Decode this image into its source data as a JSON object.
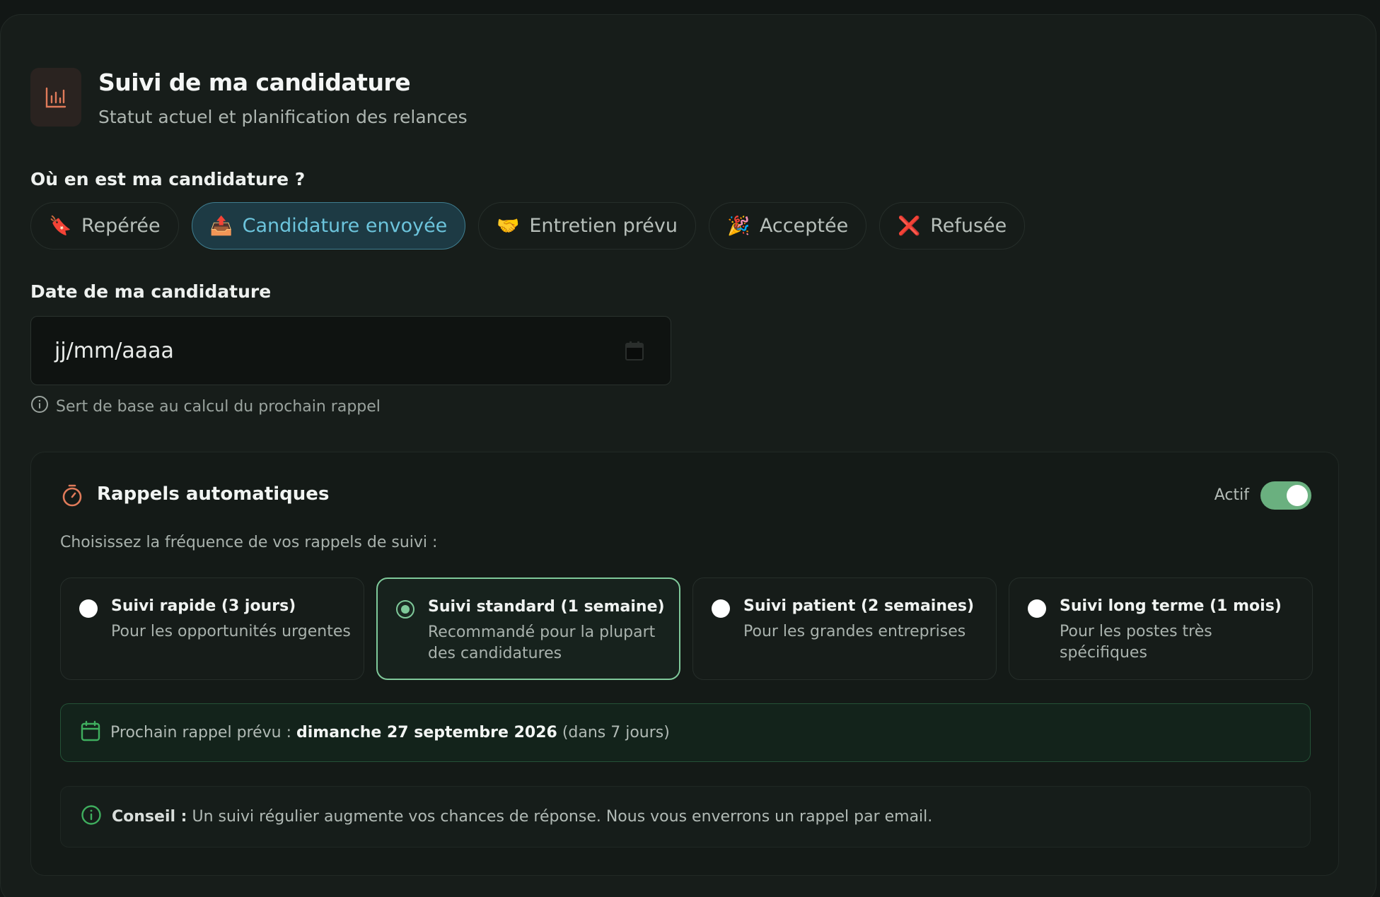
{
  "header": {
    "icon": "chart-bars-icon",
    "title": "Suivi de ma candidature",
    "subtitle": "Statut actuel et planification des relances"
  },
  "status": {
    "label": "Où en est ma candidature ?",
    "options": [
      {
        "emoji": "🔖",
        "label": "Repérée"
      },
      {
        "emoji": "📤",
        "label": "Candidature envoyée"
      },
      {
        "emoji": "🤝",
        "label": "Entretien prévu"
      },
      {
        "emoji": "🎉",
        "label": "Acceptée"
      },
      {
        "emoji": "❌",
        "label": "Refusée"
      }
    ],
    "selected": "Candidature envoyée"
  },
  "date": {
    "label": "Date de ma candidature",
    "placeholder": "jj/mm/aaaa",
    "hint": "Sert de base au calcul du prochain rappel"
  },
  "reminders": {
    "title": "Rappels automatiques",
    "toggle_label": "Actif",
    "toggle_on": true,
    "choose_label": "Choisissez la fréquence de vos rappels de suivi :",
    "options": [
      {
        "title": "Suivi rapide (3 jours)",
        "desc": "Pour les opportunités urgentes"
      },
      {
        "title": "Suivi standard (1 semaine)",
        "desc": "Recommandé pour la plupart des candidatures"
      },
      {
        "title": "Suivi patient (2 semaines)",
        "desc": "Pour les grandes entreprises"
      },
      {
        "title": "Suivi long terme (1 mois)",
        "desc": "Pour les postes très spécifiques"
      }
    ],
    "selected": "Suivi standard (1 semaine)",
    "next": {
      "prefix": "Prochain rappel prévu :",
      "date": "dimanche 27 septembre 2026",
      "suffix": "(dans 7 jours)"
    },
    "tip": {
      "label": "Conseil :",
      "text": "Un suivi régulier augmente vos chances de réponse. Nous vous enverrons un rappel par email."
    }
  },
  "colors": {
    "accent_green": "#7fc99a",
    "accent_blue": "#6cc4dc",
    "toggle_green": "#6ab07f",
    "timer_orange": "#e07b5a"
  }
}
